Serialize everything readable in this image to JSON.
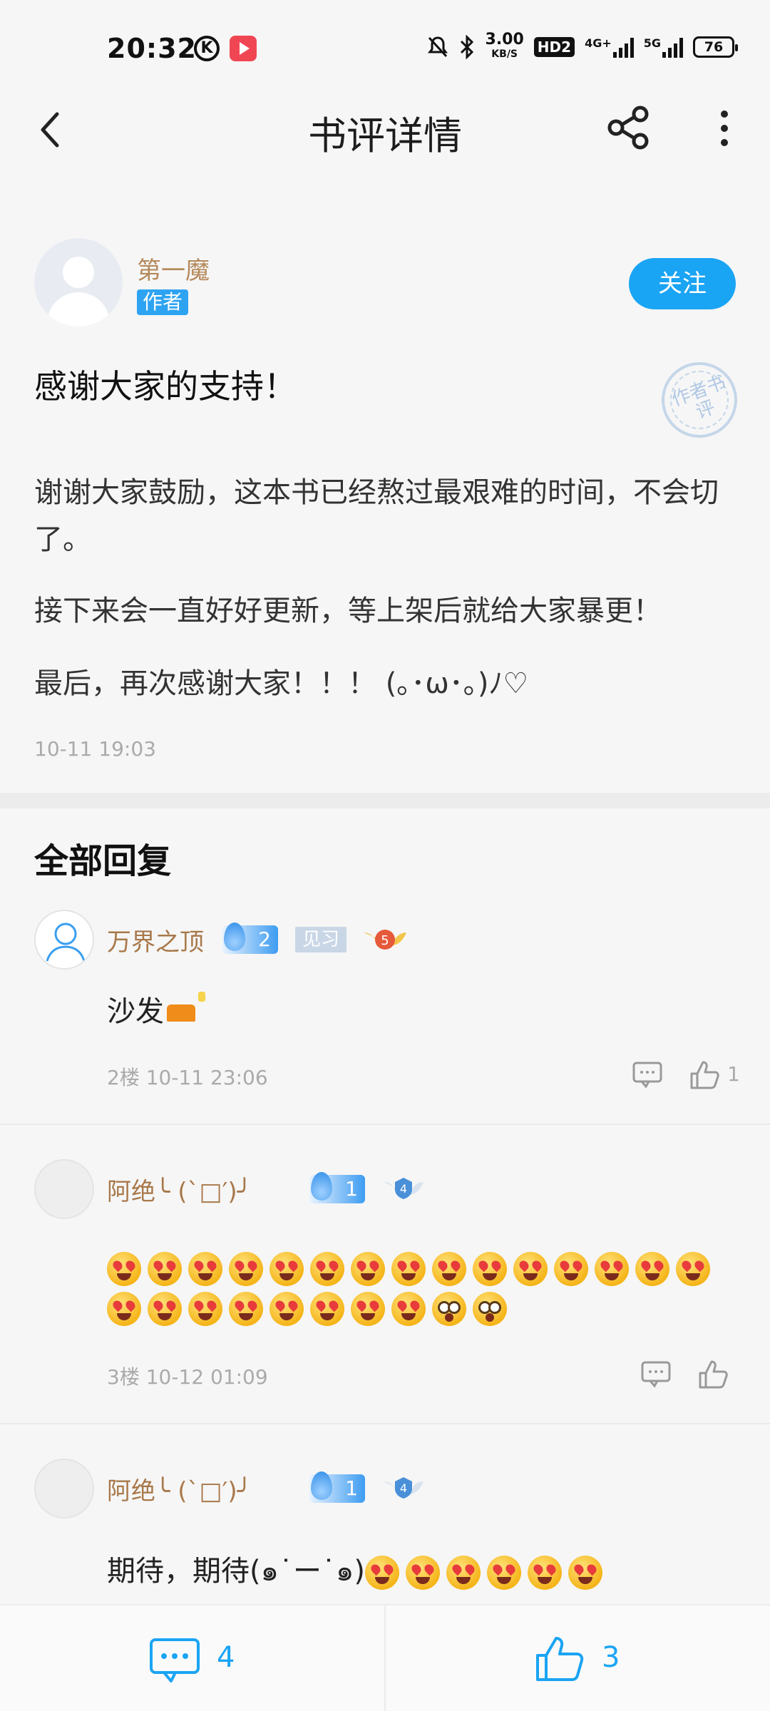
{
  "status_bar": {
    "time": "20:32",
    "speed_value": "3.00",
    "speed_unit": "KB/S",
    "hd_label": "HD2",
    "net_4g": "4G+",
    "net_5g": "5G",
    "battery": "76"
  },
  "nav": {
    "title": "书评详情"
  },
  "post": {
    "author_name": "第一魔",
    "author_tag": "作者",
    "follow_label": "关注",
    "title": "感谢大家的支持！",
    "stamp_text": "作者书评",
    "paragraphs": [
      "谢谢大家鼓励，这本书已经熬过最艰难的时间，不会切了。",
      "接下来会一直好好更新，等上架后就给大家暴更！",
      "最后，再次感谢大家！！！ (｡･ω･｡)ﾉ♡"
    ],
    "time": "10-11 19:03"
  },
  "replies_section": {
    "title": "全部回复"
  },
  "replies": [
    {
      "name": "万界之顶",
      "fire_level": "2",
      "level_tag": "见习",
      "badge_level": "5",
      "text": "沙发",
      "meta": "2楼 10-11 23:06",
      "likes": "1"
    },
    {
      "name": "阿绝╰ (`□′)╯",
      "fire_level": "1",
      "badge_level": "4",
      "meta": "3楼 10-12 01:09",
      "likes": ""
    },
    {
      "name": "阿绝╰ (`□′)╯",
      "fire_level": "1",
      "badge_level": "4",
      "text": "期待，期待(๑˙ー˙๑)"
    }
  ],
  "bottom_bar": {
    "comment_count": "4",
    "like_count": "3"
  },
  "colors": {
    "accent_blue": "#1aa4f4",
    "name_brown": "#a8784a"
  }
}
